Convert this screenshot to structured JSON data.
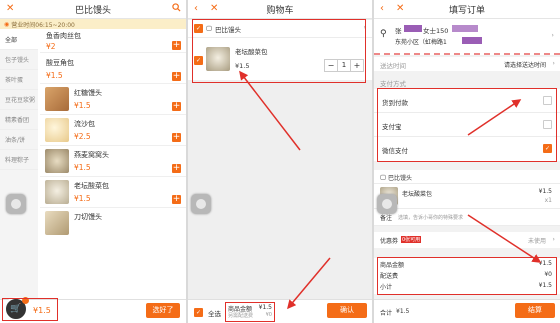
{
  "colors": {
    "accent": "#f46c17",
    "highlight": "#e0302a",
    "notice_bg": "#fbeec8"
  },
  "menu": {
    "back_icon": "close-icon",
    "title": "巴比馒头",
    "search_icon": "search-icon",
    "notice": "营业时间06:15~20:00",
    "categories": [
      "全部",
      "包子馒头",
      "茶叶蛋",
      "豆花豆浆粥",
      "精素香团",
      "油条/饼",
      "料理粽子"
    ],
    "products": [
      {
        "name": "鱼香肉丝包",
        "price": "¥2"
      },
      {
        "name": "酸豆角包",
        "price": "¥1.5"
      },
      {
        "name": "红糖馒头",
        "price": "¥1.5"
      },
      {
        "name": "流沙包",
        "price": "¥2.5"
      },
      {
        "name": "燕麦窝窝头",
        "price": "¥1.5"
      },
      {
        "name": "老坛酸菜包",
        "price": "¥1.5"
      },
      {
        "name": "刀切馒头",
        "price": ""
      }
    ],
    "cart_total": "¥1.5",
    "choose_button": "选好了"
  },
  "cart": {
    "back_icon": "close-icon",
    "title": "购物车",
    "store": "巴比馒头",
    "item_name": "老坛酸菜包",
    "item_price": "¥1.5",
    "minus": "−",
    "qty": "1",
    "plus": "+",
    "select_all": "全选",
    "goods_total_label": "商品金额",
    "goods_total": "¥1.5",
    "delivery_label": "另需配送费",
    "delivery": "¥0",
    "confirm_button": "确认"
  },
  "order": {
    "back_icon": "close-icon",
    "title": "填写订单",
    "addr_name": "张",
    "addr_suffix": "女士150",
    "addr_line": "东苑小区（虹梅路1",
    "delivery_time_label": "送达时间",
    "delivery_time_value": "请选择送达时间",
    "pay_section": "支付方式",
    "pay_options": [
      {
        "label": "货到付款",
        "checked": false
      },
      {
        "label": "支付宝",
        "checked": false
      },
      {
        "label": "微信支付",
        "checked": true
      }
    ],
    "store": "巴比馒头",
    "item_name": "老坛酸菜包",
    "item_price": "¥1.5",
    "item_qty": "x1",
    "remark_label": "备注",
    "remark_placeholder": "选填，告诉小哥你的特殊要求",
    "coupon_label": "优惠券",
    "coupon_badge": "0张可用",
    "coupon_value": "未使用",
    "summary": [
      {
        "label": "商品金额",
        "value": "¥1.5"
      },
      {
        "label": "配送费",
        "value": "¥0"
      },
      {
        "label": "小计",
        "value": "¥1.5"
      }
    ],
    "total_label": "合计",
    "total_value": "¥1.5",
    "submit_button": "结算"
  }
}
